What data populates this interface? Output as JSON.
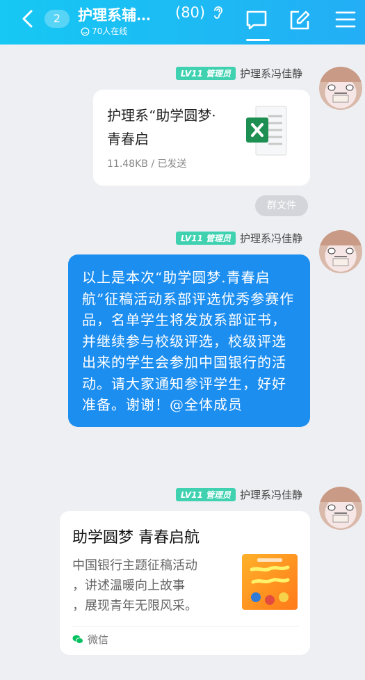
{
  "header": {
    "unread": "2",
    "title": "护理系辅…",
    "member_count": "(80)",
    "online": "70人在线"
  },
  "messages": [
    {
      "level": "LV11 管理员",
      "sender": "护理系冯佳静",
      "file_name": "护理系“助学圆梦·青春启",
      "file_meta": "11.48KB / 已发送"
    },
    {
      "pill": "群文件"
    },
    {
      "level": "LV11 管理员",
      "sender": "护理系冯佳静",
      "text": "以上是本次“助学圆梦.青春启航”征稿活动系部评选优秀参赛作品，名单学生将发放系部证书，并继续参与校级评选，校级评选出来的学生会参加中国银行的活动。请大家通知参评学生，好好准备。谢谢！@全体成员"
    },
    {
      "level": "LV11 管理员",
      "sender": "护理系冯佳静",
      "share_title": "助学圆梦 青春启航",
      "share_desc": "中国银行主题征稿活动\n，讲述温暖向上故事\n，展现青年无限风采。",
      "share_source": "微信"
    }
  ],
  "colors": {
    "header_start": "#16c8f3",
    "header_end": "#23aef5",
    "bubble": "#1c8ef0",
    "level_badge": "#3fd1b0",
    "excel_green": "#1d8f52",
    "wechat_green": "#07c160"
  }
}
